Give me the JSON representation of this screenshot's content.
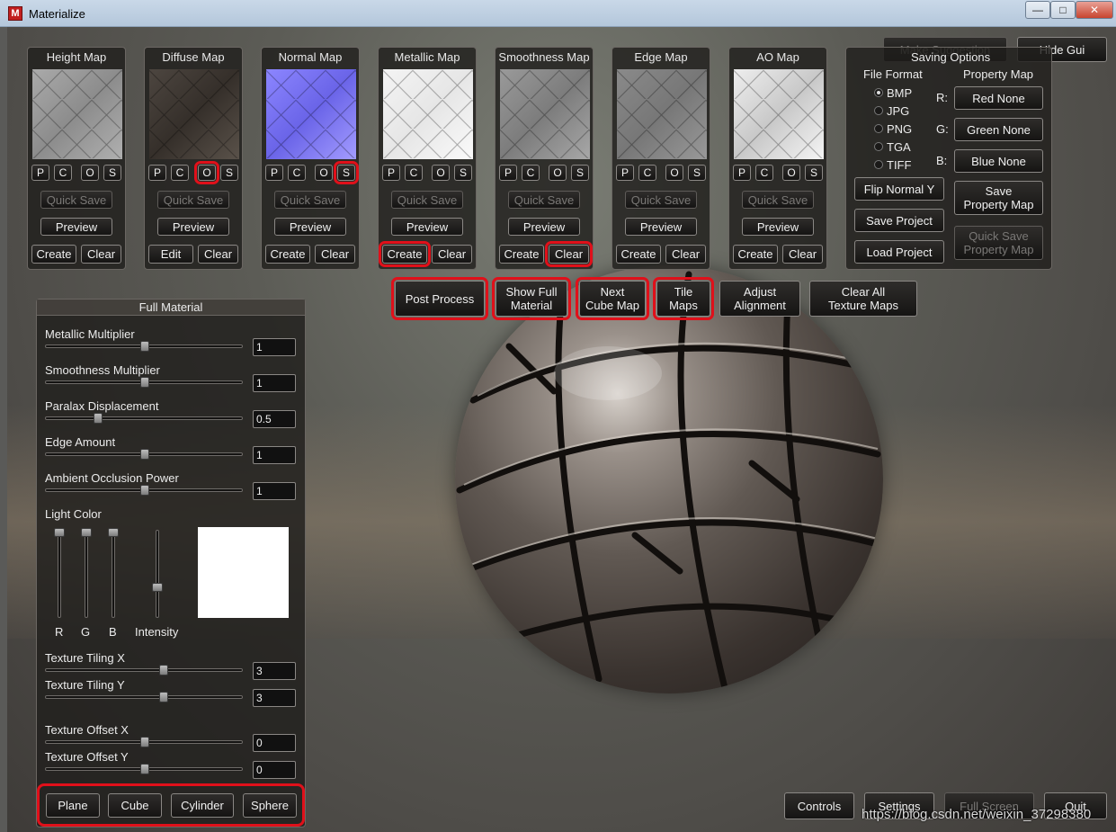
{
  "window": {
    "title": "Materialize",
    "icon_letter": "M",
    "minimize": "—",
    "maximize": "□",
    "close": "✕"
  },
  "maps": [
    {
      "title": "Height Map",
      "p": "P",
      "c": "C",
      "o": "O",
      "s": "S",
      "quick_save": "Quick Save",
      "preview": "Preview",
      "primary": "Create",
      "clear": "Clear"
    },
    {
      "title": "Diffuse Map",
      "p": "P",
      "c": "C",
      "o": "O",
      "s": "S",
      "quick_save": "Quick Save",
      "preview": "Preview",
      "primary": "Edit",
      "clear": "Clear"
    },
    {
      "title": "Normal Map",
      "p": "P",
      "c": "C",
      "o": "O",
      "s": "S",
      "quick_save": "Quick Save",
      "preview": "Preview",
      "primary": "Create",
      "clear": "Clear"
    },
    {
      "title": "Metallic Map",
      "p": "P",
      "c": "C",
      "o": "O",
      "s": "S",
      "quick_save": "Quick Save",
      "preview": "Preview",
      "primary": "Create",
      "clear": "Clear"
    },
    {
      "title": "Smoothness Map",
      "p": "P",
      "c": "C",
      "o": "O",
      "s": "S",
      "quick_save": "Quick Save",
      "preview": "Preview",
      "primary": "Create",
      "clear": "Clear"
    },
    {
      "title": "Edge Map",
      "p": "P",
      "c": "C",
      "o": "O",
      "s": "S",
      "quick_save": "Quick Save",
      "preview": "Preview",
      "primary": "Create",
      "clear": "Clear"
    },
    {
      "title": "AO Map",
      "p": "P",
      "c": "C",
      "o": "O",
      "s": "S",
      "quick_save": "Quick Save",
      "preview": "Preview",
      "primary": "Create",
      "clear": "Clear"
    }
  ],
  "top_right": {
    "make_suggestion": "Make Suggestion",
    "hide_gui": "Hide Gui"
  },
  "saving": {
    "title": "Saving Options",
    "file_format_label": "File Format",
    "formats": [
      "BMP",
      "JPG",
      "PNG",
      "TGA",
      "TIFF"
    ],
    "selected_format": "BMP",
    "property_map_label": "Property Map",
    "r_label": "R:",
    "g_label": "G:",
    "b_label": "B:",
    "r_value": "Red None",
    "g_value": "Green None",
    "b_value": "Blue None",
    "flip_normal": "Flip Normal Y",
    "save_project": "Save Project",
    "load_project": "Load Project",
    "save_property_map": "Save\nProperty Map",
    "quick_save_property_map": "Quick Save\nProperty Map"
  },
  "actions": {
    "post_process": "Post Process",
    "show_full_material": "Show Full\nMaterial",
    "next_cube_map": "Next\nCube Map",
    "tile_maps": "Tile\nMaps",
    "adjust_alignment": "Adjust\nAlignment",
    "clear_all": "Clear All\nTexture Maps"
  },
  "full_material": {
    "title": "Full Material",
    "sliders": [
      {
        "label": "Metallic Multiplier",
        "value": "1",
        "fraction": 0.5
      },
      {
        "label": "Smoothness Multiplier",
        "value": "1",
        "fraction": 0.5
      },
      {
        "label": "Paralax Displacement",
        "value": "0.5",
        "fraction": 0.25
      },
      {
        "label": "Edge Amount",
        "value": "1",
        "fraction": 0.5
      },
      {
        "label": "Ambient Occlusion Power",
        "value": "1",
        "fraction": 0.5
      }
    ],
    "light_color_label": "Light Color",
    "r": "R",
    "g": "G",
    "b": "B",
    "intensity": "Intensity",
    "light_color": "#ffffff",
    "tiling": [
      {
        "label": "Texture Tiling X",
        "value": "3",
        "fraction": 0.6
      },
      {
        "label": "Texture Tiling Y",
        "value": "3",
        "fraction": 0.6
      }
    ],
    "offset": [
      {
        "label": "Texture Offset X",
        "value": "0",
        "fraction": 0.5
      },
      {
        "label": "Texture Offset Y",
        "value": "0",
        "fraction": 0.5
      }
    ],
    "shapes": [
      "Plane",
      "Cube",
      "Cylinder",
      "Sphere"
    ]
  },
  "bottom": {
    "controls": "Controls",
    "settings": "Settings",
    "full_screen": "Full Screen",
    "quit": "Quit"
  },
  "watermark": "https://blog.csdn.net/weixin_37298380",
  "highlight_color": "#e0101a"
}
